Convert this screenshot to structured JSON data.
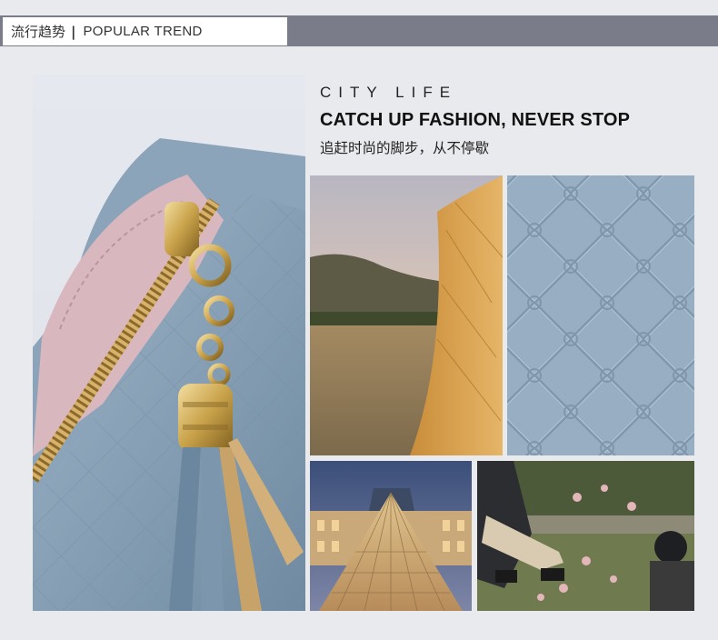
{
  "header": {
    "title_cn": "流行趋势",
    "separator": "|",
    "title_en": "POPULAR TREND"
  },
  "feature": {
    "kicker": "CITY LIFE",
    "headline": "CATCH UP FASHION, NEVER STOP",
    "subhead_cn": "追赶时尚的脚步，从不停歇"
  },
  "colors": {
    "header_bar": "#7b7c8a",
    "page_bg": "#e9eaee",
    "wallet_blue": "#8aa3b8",
    "wallet_pink": "#d9b7bf",
    "gold": "#c9a24a"
  }
}
